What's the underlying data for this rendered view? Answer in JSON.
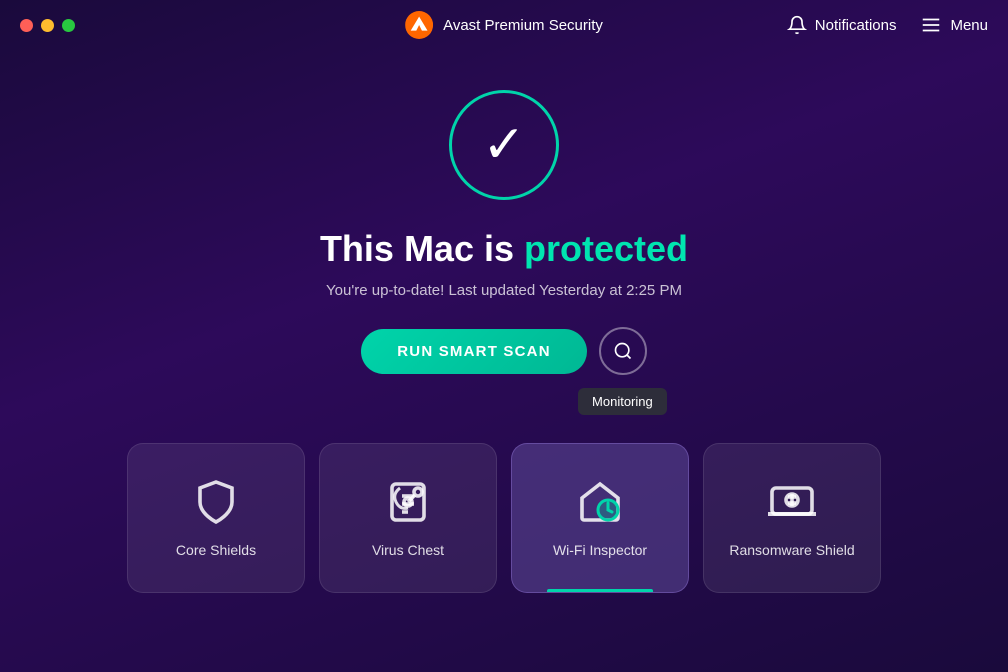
{
  "app": {
    "title": "Avast Premium Security"
  },
  "titlebar": {
    "notifications_label": "Notifications",
    "menu_label": "Menu"
  },
  "main": {
    "status_heading_static": "This Mac is",
    "status_heading_emphasis": "protected",
    "status_subtitle": "You're up-to-date! Last updated Yesterday at 2:25 PM",
    "run_scan_label": "RUN SMART SCAN",
    "monitoring_tooltip": "Monitoring"
  },
  "cards": [
    {
      "id": "core-shields",
      "label": "Core Shields",
      "icon": "shield",
      "active": false
    },
    {
      "id": "virus-chest",
      "label": "Virus Chest",
      "icon": "biohazard",
      "active": false
    },
    {
      "id": "wifi-inspector",
      "label": "Wi-Fi Inspector",
      "icon": "wifi-shield",
      "active": true
    },
    {
      "id": "ransomware-shield",
      "label": "Ransomware Shield",
      "icon": "laptop-lock",
      "active": false
    }
  ]
}
